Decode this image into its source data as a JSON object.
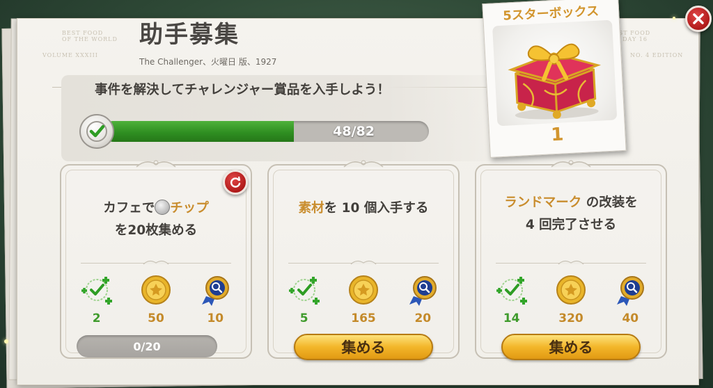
{
  "header": {
    "title": "助手募集",
    "subtitle": "The Challenger、火曜日 版、1927"
  },
  "objective": {
    "text": "事件を解決してチャレンジャー賞品を入手しよう！",
    "progress_text": "48/82",
    "progress_current": 48,
    "progress_total": 82
  },
  "reward": {
    "title": "5スターボックス",
    "count": "1"
  },
  "tasks": [
    {
      "title_pre": "カフェで",
      "title_hl": "チップ",
      "title_post": "を20枚集める",
      "rewards": {
        "checks": "2",
        "coins": "50",
        "medals": "10"
      },
      "progress_text": "0/20"
    },
    {
      "title_hl": "素材",
      "title_post": "を 10 個入手する",
      "rewards": {
        "checks": "5",
        "coins": "165",
        "medals": "20"
      },
      "button_label": "集める"
    },
    {
      "title_hl": "ランドマーク",
      "title_post": " の改装を 4 回完了させる",
      "rewards": {
        "checks": "14",
        "coins": "320",
        "medals": "40"
      },
      "button_label": "集める"
    }
  ],
  "colors": {
    "accent_gold": "#c98d2e",
    "progress_green": "#2f8f22",
    "close_red": "#b01a1a"
  },
  "icons": {
    "close": "close-icon",
    "refresh": "refresh-icon",
    "check": "check-icon",
    "checks_reward": "check-plus-icon",
    "coin_reward": "gold-coin-icon",
    "medal_reward": "magnifier-medal-icon",
    "gift": "gift-box-icon"
  }
}
